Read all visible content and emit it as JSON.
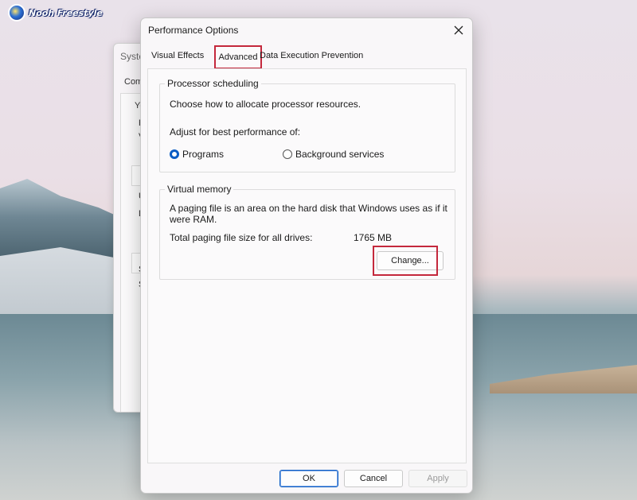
{
  "watermark": {
    "text": "Nooh Freestyle"
  },
  "background_window": {
    "title": "Syste",
    "tab": "Com",
    "letters": [
      "Yo",
      "F",
      "V",
      "U",
      "D",
      "S",
      "S"
    ]
  },
  "dialog": {
    "title": "Performance Options",
    "tabs": [
      {
        "label": "Visual Effects",
        "active": false
      },
      {
        "label": "Advanced",
        "active": true
      },
      {
        "label": "Data Execution Prevention",
        "active": false
      }
    ],
    "processor_scheduling": {
      "legend": "Processor scheduling",
      "description": "Choose how to allocate processor resources.",
      "adjust_label": "Adjust for best performance of:",
      "options": [
        {
          "label": "Programs",
          "selected": true
        },
        {
          "label": "Background services",
          "selected": false
        }
      ]
    },
    "virtual_memory": {
      "legend": "Virtual memory",
      "description_line1": "A paging file is an area on the hard disk that Windows uses as if it",
      "description_line2": "were RAM.",
      "total_label": "Total paging file size for all drives:",
      "total_value": "1765 MB",
      "change_button": "Change..."
    },
    "footer": {
      "ok": "OK",
      "cancel": "Cancel",
      "apply": "Apply"
    },
    "highlight_color": "#c4283c",
    "accent_color": "#0b5cc4"
  }
}
